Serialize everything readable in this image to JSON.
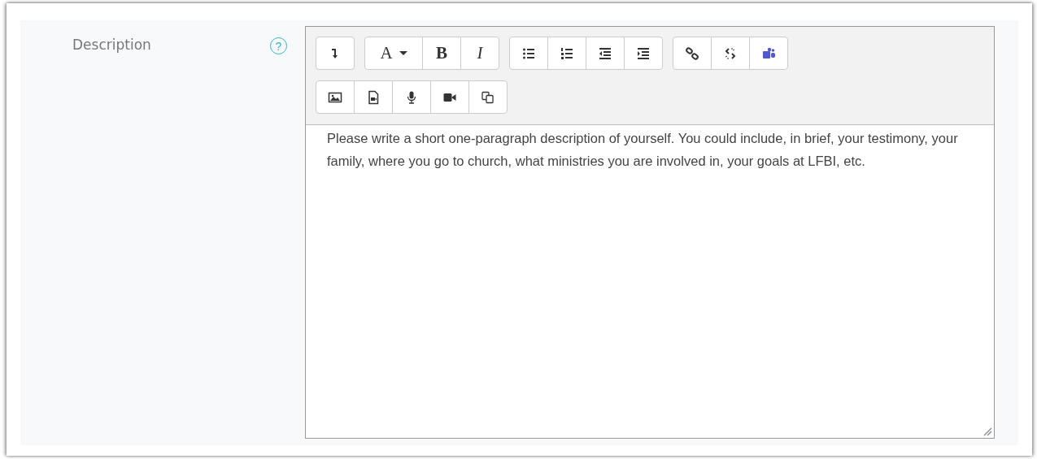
{
  "field": {
    "label": "Description",
    "help": "?"
  },
  "toolbar": {
    "rows": [
      [
        [
          {
            "kind": "collapse"
          }
        ],
        [
          {
            "kind": "font",
            "text": "A"
          },
          {
            "kind": "bold",
            "text": "B"
          },
          {
            "kind": "italic",
            "text": "I"
          }
        ],
        [
          {
            "kind": "bullets"
          },
          {
            "kind": "numbers"
          },
          {
            "kind": "outdent"
          },
          {
            "kind": "indent"
          }
        ],
        [
          {
            "kind": "link"
          },
          {
            "kind": "unlink"
          },
          {
            "kind": "teams"
          }
        ]
      ],
      [
        [
          {
            "kind": "image"
          },
          {
            "kind": "media"
          },
          {
            "kind": "mic"
          },
          {
            "kind": "video"
          },
          {
            "kind": "copy"
          }
        ]
      ]
    ]
  },
  "editor": {
    "value": "Please write a short one-paragraph description of yourself. You could include, in brief, your testimony, your family, where you go to church, what ministries you are involved in, your goals at LFBI, etc."
  }
}
